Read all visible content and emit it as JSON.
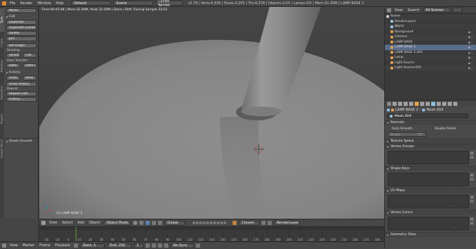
{
  "topbar": {
    "menus": [
      "File",
      "Render",
      "Window",
      "Help"
    ],
    "screen_layout": "Default",
    "scene": "Scene",
    "engine": "Cycles Render",
    "stats": "v2.78 | Verts:4,636 | Faces:4,205 | Tris:8,578 | Objects:1/25 | Lamps:0/5 | Mem:91.45M | LAMP BASE 2"
  },
  "toolshelf": {
    "tabs": [
      "Tools",
      "Create",
      "Relations",
      "Animation",
      "Physics",
      "Grease Pencil"
    ],
    "mirror_label": "Mirror",
    "edit_section": "Edit",
    "buttons_edit": [
      "Duplicate",
      "Duplicate Linked",
      "Delete",
      "Join"
    ],
    "set_origin": "Set Origin",
    "shading_label": "Shading:",
    "smooth": "Smooth",
    "flat": "Flat",
    "data_transfer_label": "Data Transfer:",
    "data": "Data",
    "data_layout": "Data L",
    "history_section": "History",
    "undo": "Undo",
    "redo": "Redo",
    "undo_history": "Undo History",
    "repeat_label": "Repeat:",
    "repeat_last": "Repeat Last",
    "history": "History ...",
    "operator_panel": "Shade Smooth"
  },
  "viewport": {
    "render_status": "Time:00:45.68 | Mem:32.00M, Peak:32.00M | Done | Path Tracing Sample 32/32",
    "object_label": "(1) LAMP BASE 2"
  },
  "viewport_header": {
    "editor_icon": "3d-view-icon",
    "menus": [
      "View",
      "Select",
      "Add",
      "Object"
    ],
    "mode": "Object Mode",
    "orientation": "Global",
    "snap": "Closest",
    "render_layer": "RenderLayer"
  },
  "timeline": {
    "ticks": [
      "-20",
      "-10",
      "0",
      "10",
      "20",
      "30",
      "40",
      "50",
      "60",
      "70",
      "80",
      "90",
      "100",
      "110",
      "120",
      "130",
      "140",
      "150",
      "160",
      "170",
      "180",
      "190",
      "200",
      "210",
      "220",
      "230",
      "240",
      "250",
      "260",
      "270",
      "280"
    ],
    "current_frame_fraction": 0.09
  },
  "timeline_header": {
    "menus": [
      "View",
      "Marker",
      "Frame",
      "Playback"
    ],
    "start": "Start:",
    "start_value": "1",
    "end": "End:",
    "end_value": "250",
    "current": "1",
    "sync": "No Sync"
  },
  "outliner": {
    "menus": [
      "View",
      "Search"
    ],
    "filter": "All Scenes",
    "rows": [
      {
        "name": "Scene",
        "color": "#c8c8c8"
      },
      {
        "name": "RenderLayers",
        "color": "#9ac6e0"
      },
      {
        "name": "World",
        "color": "#9ac6e0"
      },
      {
        "name": "Background",
        "color": "#e0a050"
      },
      {
        "name": "Camera",
        "color": "#e0a050"
      },
      {
        "name": "LAMP BASE",
        "color": "#e0a050"
      },
      {
        "name": "LAMP BASE 2",
        "color": "#e0a050",
        "selected": true
      },
      {
        "name": "LAMP BASE 2.001",
        "color": "#e0a050"
      },
      {
        "name": "Lamp",
        "color": "#e0a050"
      },
      {
        "name": "Light Source",
        "color": "#e0a050"
      },
      {
        "name": "Light Source.001",
        "color": "#e0a050"
      }
    ]
  },
  "properties": {
    "breadcrumb_object": "LAMP BASE 2",
    "breadcrumb_mesh": "Mesh.004",
    "datablock": "Mesh.004",
    "normals": "Normals",
    "auto_smooth": "Auto Smooth",
    "double_sided": "Double Sided",
    "angle_label": "Angle:",
    "angle_value": "30°",
    "texture_space": "Texture Space",
    "vertex_groups": "Vertex Groups",
    "shape_keys": "Shape Keys",
    "uv_maps": "UV Maps",
    "vertex_colors": "Vertex Colors",
    "geometry_data": "Geometry Data"
  }
}
